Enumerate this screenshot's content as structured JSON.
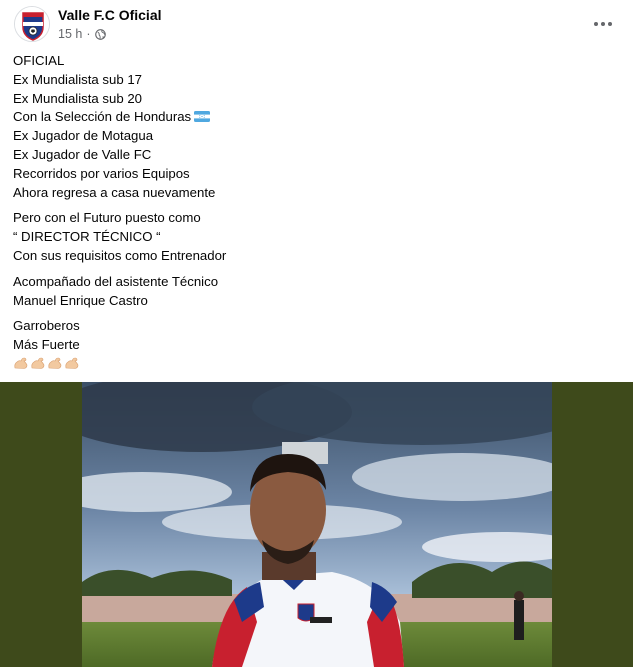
{
  "post": {
    "page_name": "Valle F.C Oficial",
    "time": "15 h",
    "separator": "·",
    "privacy_icon": "globe-icon",
    "more_icon": "more-options-icon"
  },
  "content": {
    "paragraphs": [
      {
        "lines": [
          "OFICIAL",
          "Ex Mundialista sub 17",
          "Ex Mundialista sub 20",
          "Con la Selección de Honduras",
          "Ex Jugador de Motagua",
          "Ex Jugador de Valle FC",
          "Recorridos por varios Equipos",
          "Ahora regresa a casa nuevamente"
        ]
      },
      {
        "lines": [
          "Pero con el Futuro puesto como",
          "“ DIRECTOR TÉCNICO “",
          "Con sus requisitos como Entrenador"
        ]
      },
      {
        "lines": [
          "Acompañado del asistente Técnico",
          "Manuel Enrique Castro"
        ]
      },
      {
        "lines": [
          "Garroberos",
          "Más Fuerte"
        ]
      }
    ],
    "emoji_flag": "honduras-flag-emoji",
    "emoji_arms": [
      "flexed-biceps-emoji",
      "flexed-biceps-emoji",
      "flexed-biceps-emoji",
      "flexed-biceps-emoji"
    ]
  },
  "colors": {
    "photo_background": "#3e4a1b",
    "secondary_text": "#65676b",
    "primary_text": "#050505"
  }
}
